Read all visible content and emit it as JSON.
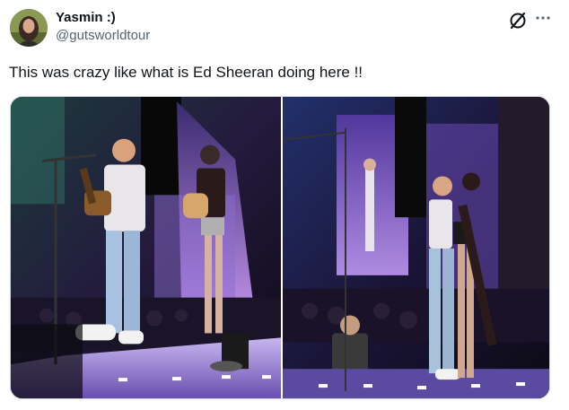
{
  "author": {
    "display_name": "Yasmin :)",
    "handle": "@gutsworldtour"
  },
  "tweet": {
    "text": "This was crazy like what is Ed Sheeran doing here !!"
  },
  "icons": {
    "logo": "x-logo-icon",
    "more": "more-options-icon"
  },
  "media": {
    "count": 2,
    "items": [
      "concert-photo-left",
      "concert-photo-right"
    ]
  }
}
